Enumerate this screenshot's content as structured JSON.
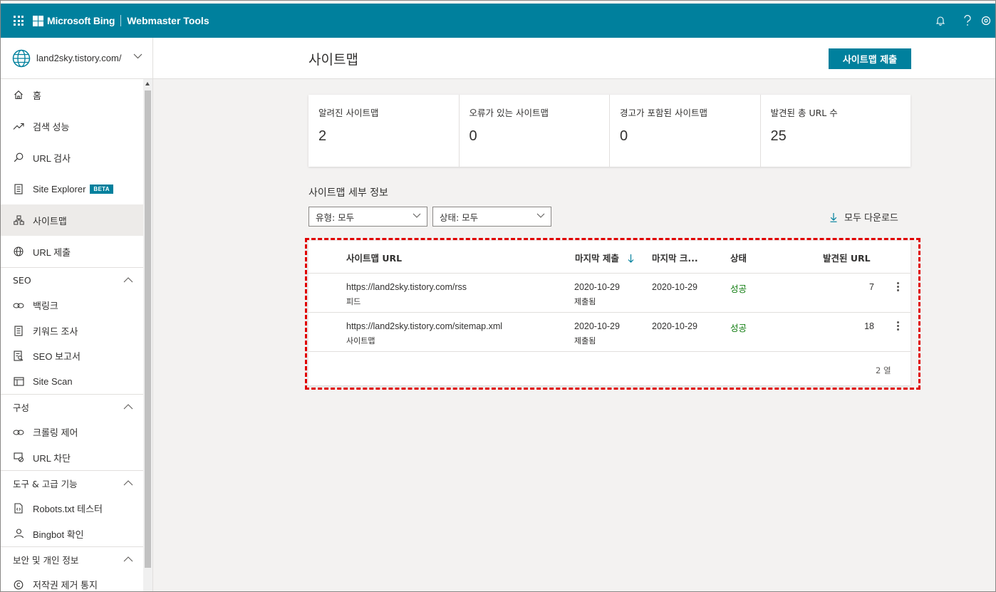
{
  "topbar": {
    "brand": "Microsoft Bing",
    "product": "Webmaster Tools"
  },
  "site": {
    "name": "land2sky.tistory.com/"
  },
  "nav": {
    "items_top": [
      {
        "label": "홈",
        "icon": "home-icon"
      },
      {
        "label": "검색 성능",
        "icon": "trend-icon"
      },
      {
        "label": "URL 검사",
        "icon": "search-icon"
      },
      {
        "label": "Site Explorer",
        "icon": "document-icon",
        "badge": "BETA"
      },
      {
        "label": "사이트맵",
        "icon": "sitemap-icon",
        "active": true
      },
      {
        "label": "URL 제출",
        "icon": "globe-icon"
      }
    ],
    "sections": [
      {
        "title": "SEO",
        "items": [
          "백링크",
          "키워드 조사",
          "SEO 보고서",
          "Site Scan"
        ]
      },
      {
        "title": "구성",
        "items": [
          "크롤링 제어",
          "URL 차단"
        ]
      },
      {
        "title": "도구 & 고급 기능",
        "items": [
          "Robots.txt 테스터",
          "Bingbot 확인"
        ]
      },
      {
        "title": "보안 및 개인 정보",
        "items": [
          "저작권 제거 통지"
        ]
      }
    ]
  },
  "page": {
    "title": "사이트맵",
    "submit_button": "사이트맵 제출"
  },
  "cards": [
    {
      "label": "알려진 사이트맵",
      "value": "2"
    },
    {
      "label": "오류가 있는 사이트맵",
      "value": "0"
    },
    {
      "label": "경고가 포함된 사이트맵",
      "value": "0"
    },
    {
      "label": "발견된 총 URL 수",
      "value": "25"
    }
  ],
  "details": {
    "title": "사이트맵 세부 정보",
    "filter_type": "유형: 모두",
    "filter_status": "상태: 모두",
    "download_all": "모두 다운로드"
  },
  "table": {
    "headers": {
      "url": "사이트맵 URL",
      "last_submitted": "마지막 제출",
      "last_crawled": "마지막 크...",
      "status": "상태",
      "discovered": "발견된 URL"
    },
    "rows": [
      {
        "url": "https://land2sky.tistory.com/rss",
        "type": "피드",
        "submitted_date": "2020-10-29",
        "submitted_label": "제출됨",
        "crawled_date": "2020-10-29",
        "status": "성공",
        "discovered": "7"
      },
      {
        "url": "https://land2sky.tistory.com/sitemap.xml",
        "type": "사이트맵",
        "submitted_date": "2020-10-29",
        "submitted_label": "제출됨",
        "crawled_date": "2020-10-29",
        "status": "성공",
        "discovered": "18"
      }
    ],
    "row_count": "2 열"
  },
  "colors": {
    "accent": "#00809d",
    "success": "#107c10",
    "highlight": "#e00000"
  }
}
